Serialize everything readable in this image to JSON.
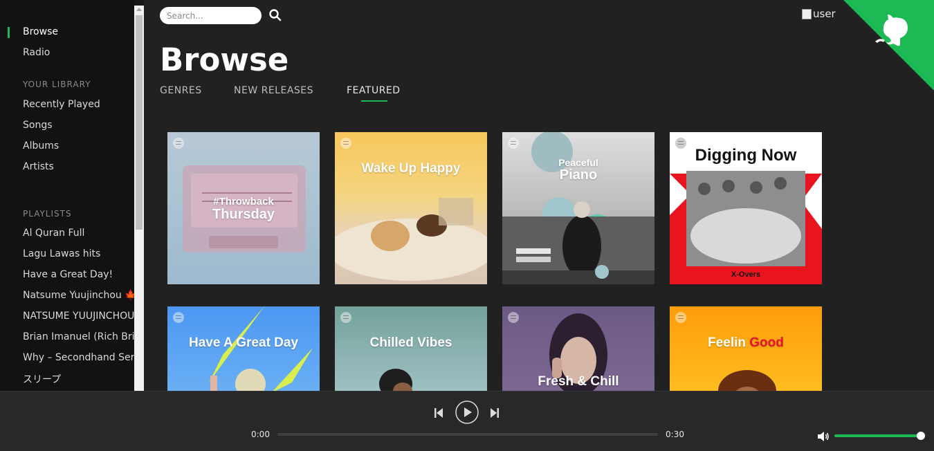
{
  "sidebar": {
    "nav": [
      {
        "label": "Browse"
      },
      {
        "label": "Radio"
      }
    ],
    "library_heading": "YOUR LIBRARY",
    "library": [
      {
        "label": "Recently Played"
      },
      {
        "label": "Songs"
      },
      {
        "label": "Albums"
      },
      {
        "label": "Artists"
      }
    ],
    "playlists_heading": "PLAYLISTS",
    "playlists": [
      {
        "label": "Al Quran Full"
      },
      {
        "label": "Lagu Lawas hits"
      },
      {
        "label": "Have a Great Day!"
      },
      {
        "label": "Natsume Yuujinchou 🍁"
      },
      {
        "label": "NATSUME YUUJINCHOU"
      },
      {
        "label": "Brian Imanuel (Rich Brian)"
      },
      {
        "label": "Why – Secondhand Serenade"
      },
      {
        "label": "スリープ"
      }
    ]
  },
  "header": {
    "search_placeholder": "Search...",
    "user_alt": "user"
  },
  "main": {
    "title": "Browse",
    "tabs": [
      {
        "label": "GENRES"
      },
      {
        "label": "NEW RELEASES"
      },
      {
        "label": "FEATURED"
      }
    ]
  },
  "playlists_grid": [
    {
      "line1": "#Throwback",
      "line2": "Thursday"
    },
    {
      "line1": "Wake Up Happy"
    },
    {
      "line1": "Peaceful",
      "line2": "Piano"
    },
    {
      "line1": "Digging Now",
      "subtitle": "X-Overs"
    },
    {
      "line1": "Have A Great Day"
    },
    {
      "line1": "Chilled Vibes"
    },
    {
      "line1": "Fresh & Chill"
    },
    {
      "line1": "Feelin",
      "line2": "Good"
    }
  ],
  "player": {
    "time_current": "0:00",
    "time_total": "0:30",
    "progress": 0,
    "volume": 1.0
  },
  "colors": {
    "accent": "#1db954",
    "sidebar_bg": "#121212",
    "main_bg": "#212121",
    "player_bg": "#282828"
  }
}
